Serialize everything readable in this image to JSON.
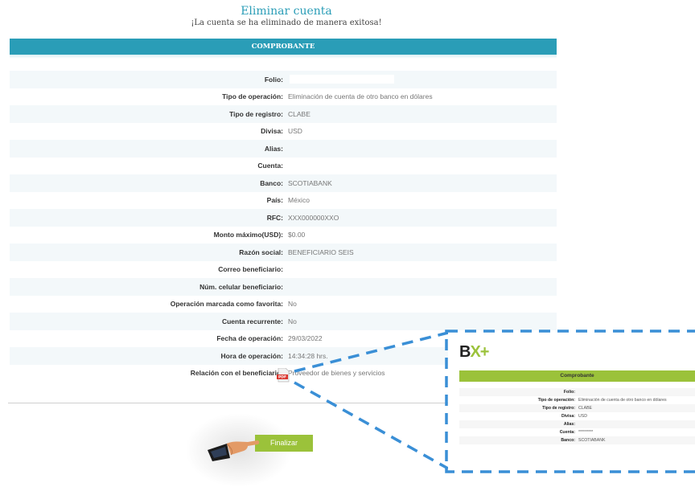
{
  "header": {
    "title": "Eliminar cuenta",
    "subtitle": "¡La cuenta se ha eliminado de manera exitosa!"
  },
  "voucher": {
    "heading": "COMPROBANTE",
    "rows": [
      {
        "label": "Folio:",
        "value": ""
      },
      {
        "label": "Tipo de operación:",
        "value": "Eliminación de cuenta de otro banco en dólares"
      },
      {
        "label": "Tipo de registro:",
        "value": "CLABE"
      },
      {
        "label": "Divisa:",
        "value": "USD"
      },
      {
        "label": "Alias:",
        "value": ""
      },
      {
        "label": "Cuenta:",
        "value": ""
      },
      {
        "label": "Banco:",
        "value": "SCOTIABANK"
      },
      {
        "label": "País:",
        "value": "México"
      },
      {
        "label": "RFC:",
        "value": "XXX000000XXO"
      },
      {
        "label": "Monto máximo(USD):",
        "value": "$0.00"
      },
      {
        "label": "Razón social:",
        "value": "BENEFICIARIO SEIS"
      },
      {
        "label": "Correo beneficiario:",
        "value": ""
      },
      {
        "label": "Núm. celular beneficiario:",
        "value": ""
      },
      {
        "label": "Operación marcada como favorita:",
        "value": "No"
      },
      {
        "label": "Cuenta recurrente:",
        "value": "No"
      },
      {
        "label": "Fecha de operación:",
        "value": "29/03/2022"
      },
      {
        "label": "Hora de operación:",
        "value": "14:34:28 hrs."
      },
      {
        "label": "Relación con el beneficiario:",
        "value": "Proveedor de bienes y servicios"
      }
    ],
    "pdf_icon": "pdf-file-icon",
    "pdf_label": "PDF"
  },
  "actions": {
    "finish_label": "Finalizar"
  },
  "zoom_preview": {
    "brand_b": "B",
    "brand_x": "X+",
    "heading": "Comprobante",
    "rows": [
      {
        "label": "Folio:",
        "value": ""
      },
      {
        "label": "Tipo de operación:",
        "value": "Eliminación de cuenta de otro banco en dólares"
      },
      {
        "label": "Tipo de registro:",
        "value": "CLABE"
      },
      {
        "label": "Divisa:",
        "value": "USD"
      },
      {
        "label": "Alias:",
        "value": ""
      },
      {
        "label": "Cuenta:",
        "value": "*********"
      },
      {
        "label": "Banco:",
        "value": "SCOTIABANK"
      }
    ]
  },
  "colors": {
    "accent": "#2a9db7",
    "brand_green": "#9bc23a",
    "dash_blue": "#3a8fd6"
  }
}
